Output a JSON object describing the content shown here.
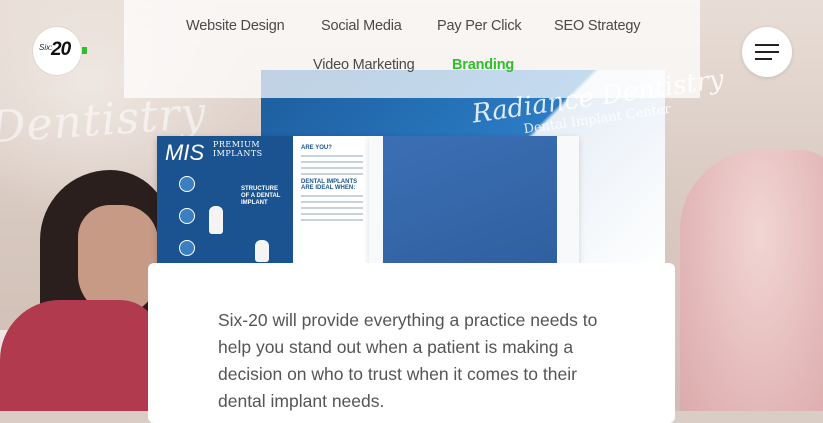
{
  "brand": {
    "logo_prefix": "Six",
    "logo_number": "20",
    "accent_color": "#2fbf2b"
  },
  "nav": {
    "items": [
      {
        "label": "Website Design",
        "active": false
      },
      {
        "label": "Social Media",
        "active": false
      },
      {
        "label": "Pay Per Click",
        "active": false
      },
      {
        "label": "SEO Strategy",
        "active": false
      },
      {
        "label": "Video Marketing",
        "active": false
      },
      {
        "label": "Branding",
        "active": true
      }
    ],
    "menu_icon": "hamburger-icon"
  },
  "hero": {
    "wall_sign": "Dentistry",
    "brochure": {
      "practice_name": "Radiance Dentistry",
      "practice_subtitle": "Dental Implant Center",
      "brand_mark": "MIS",
      "brand_tagline": "PREMIUM IMPLANTS",
      "feature_heading": "STRUCTURE OF A DENTAL IMPLANT",
      "side_heading_1": "ARE YOU?",
      "side_heading_2": "DENTAL IMPLANTS ARE IDEAL WHEN:"
    }
  },
  "content": {
    "body": "Six-20 will provide everything a practice needs to help you stand out when a patient is making a decision on who to trust when it comes to their dental implant needs."
  }
}
